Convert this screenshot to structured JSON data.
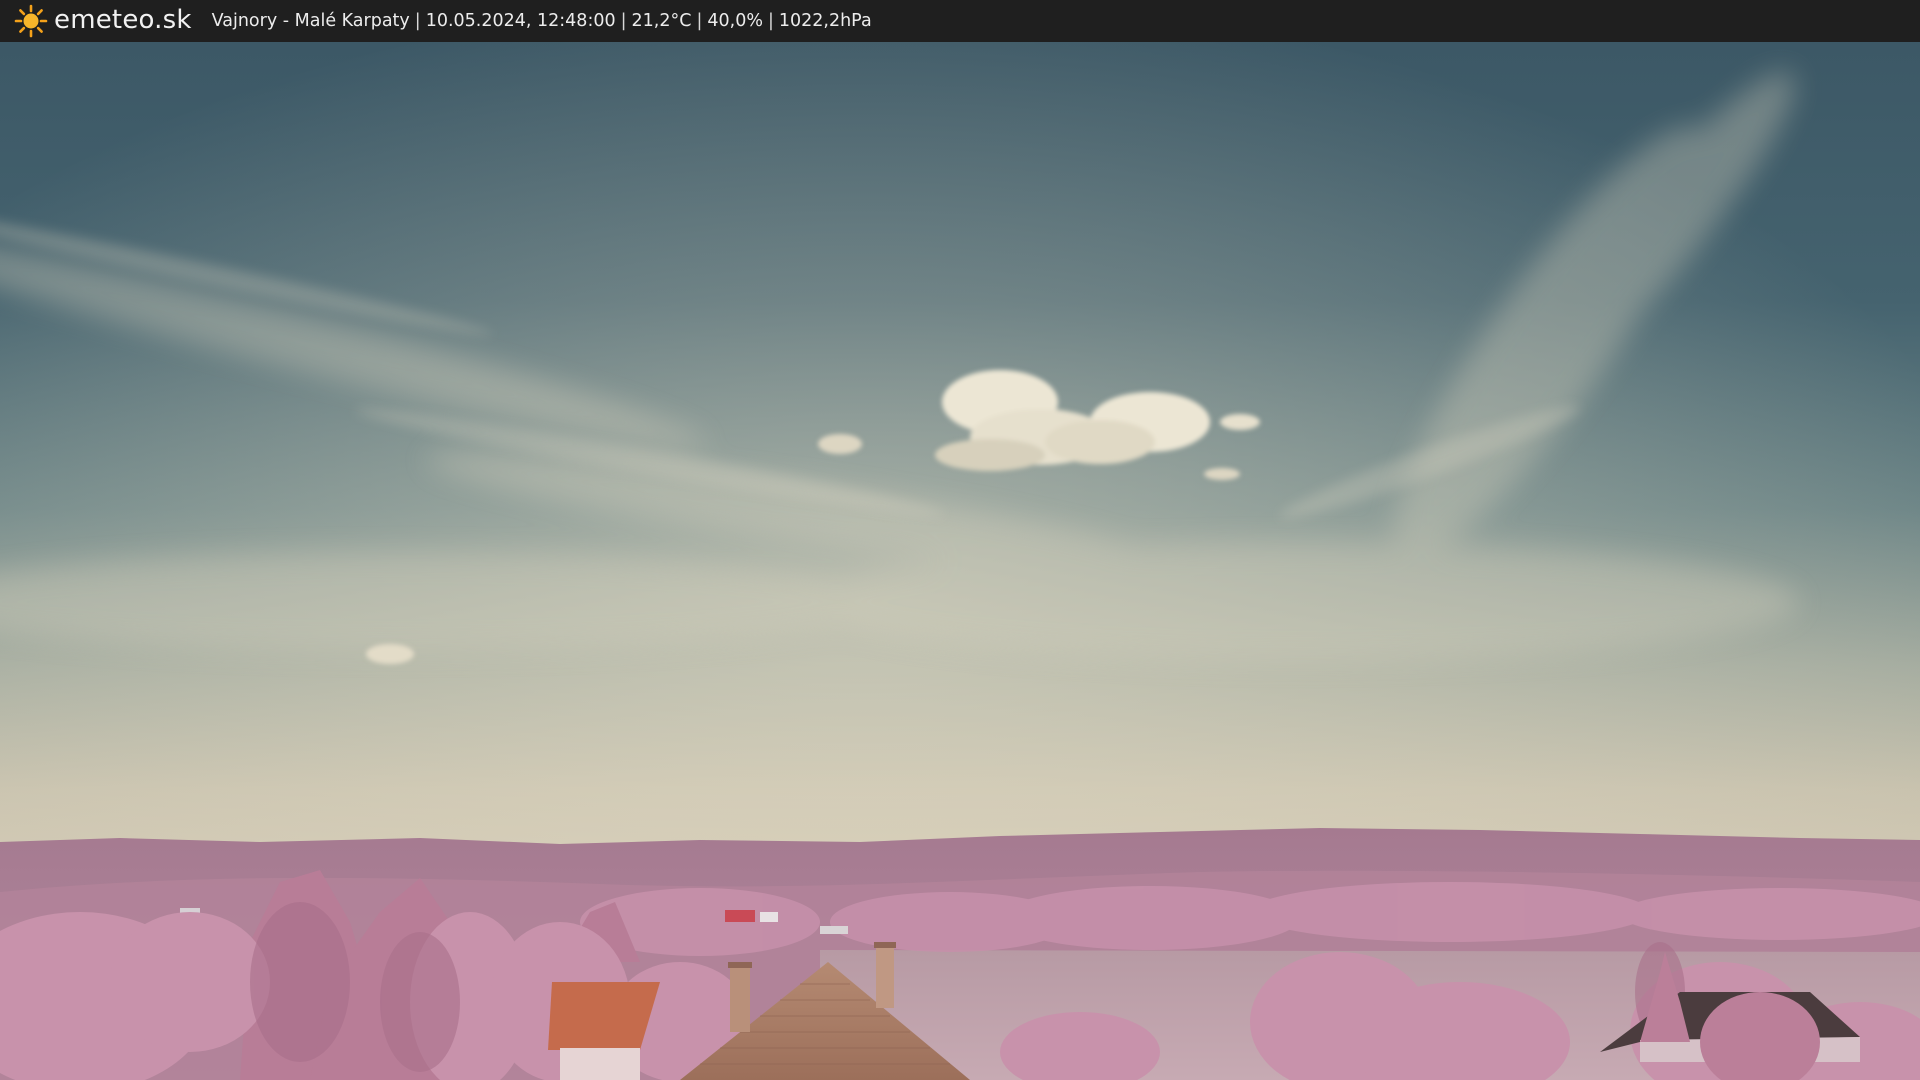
{
  "header": {
    "brand": "emeteo.sk",
    "location": "Vajnory - Malé Karpaty",
    "datetime": "10.05.2024, 12:48:00",
    "temperature": "21,2°C",
    "humidity": "40,0%",
    "pressure": "1022,2hPa",
    "separator": "|",
    "logo_icon": "sun-icon"
  },
  "colors": {
    "bar_background": "#1f1f1f",
    "sky_top": "#3f5a68",
    "sky_horizon": "#cfc7b2",
    "hills": "#a97f94",
    "foliage": "#c28ea6",
    "roof": "#c46b4a"
  }
}
